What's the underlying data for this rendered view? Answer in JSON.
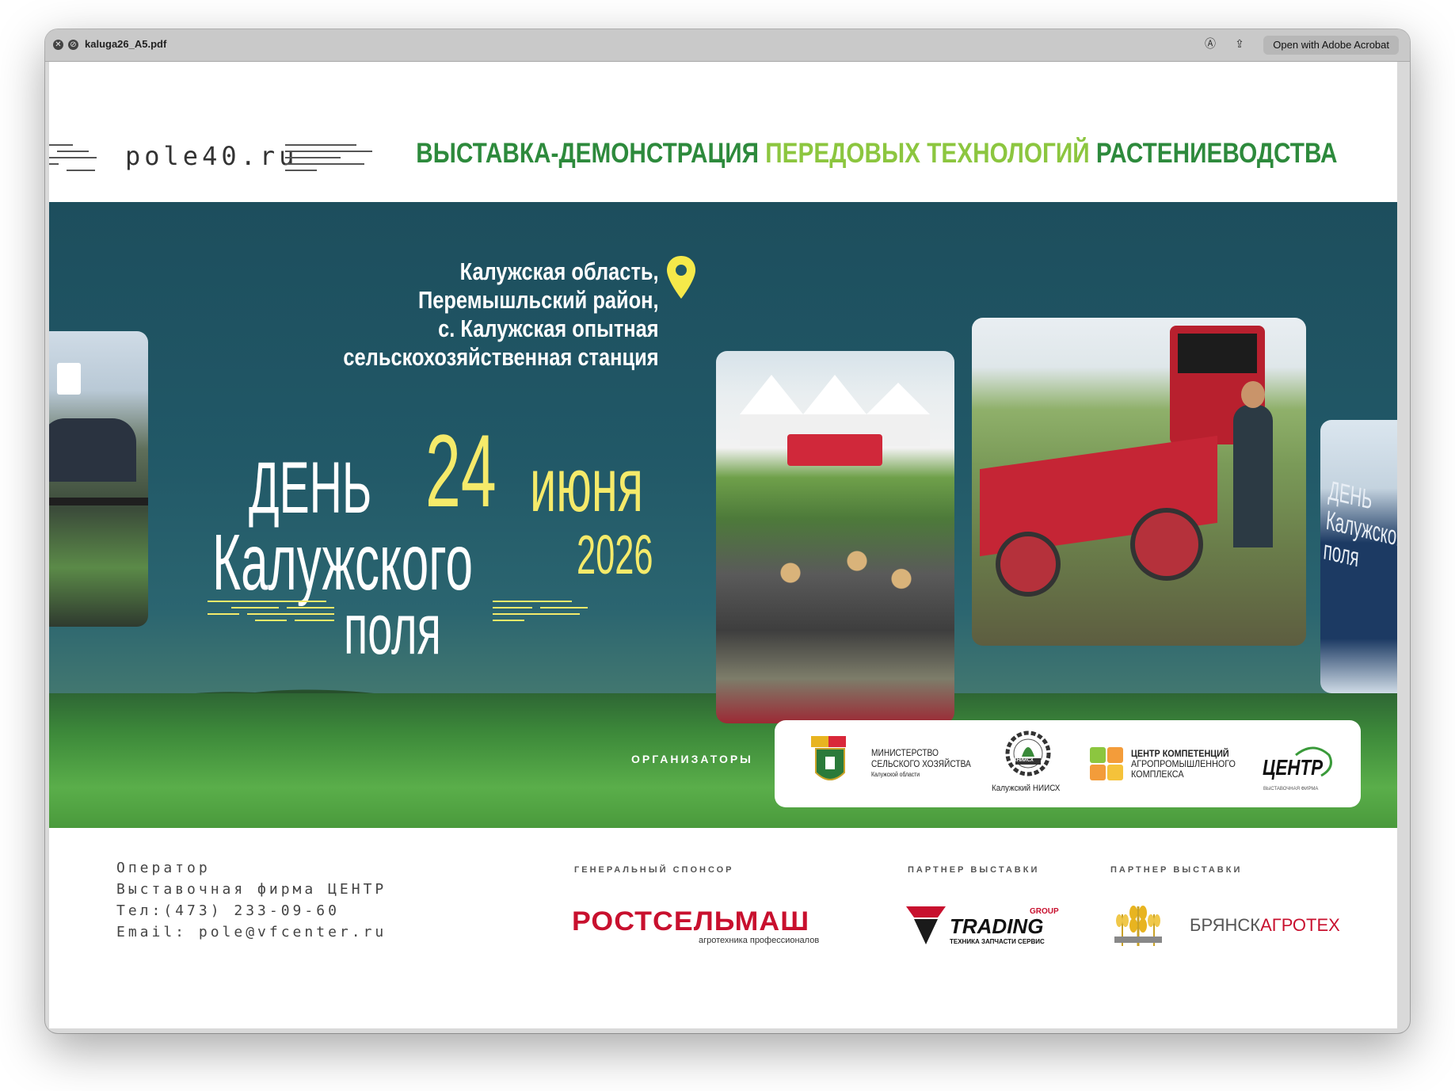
{
  "window": {
    "filename": "kaluga26_A5.pdf",
    "open_with_label": "Open with Adobe Acrobat"
  },
  "document": {
    "site": "pole40.ru",
    "headline_part1": "ВЫСТАВКА-ДЕМОНСТРАЦИЯ ",
    "headline_part2": "ПЕРЕДОВЫХ ТЕХНОЛОГИЙ ",
    "headline_part3": "РАСТЕНИЕВОДСТВА",
    "address": [
      "Калужская область,",
      "Перемышльский район,",
      "с. Калужская опытная",
      "сельскохозяйственная станция"
    ],
    "event_line1": "ДЕНЬ",
    "event_line2": "Калужского",
    "event_line3": "поля",
    "date_day": "24",
    "date_month": "июня",
    "date_year": "2026",
    "photo_banner_text": [
      "ДЕНЬ",
      "Калужского",
      "поля"
    ],
    "organizers_label": "ОРГАНИЗАТОРЫ",
    "organizers": {
      "ministry": [
        "МИНИСТЕРСТВО",
        "СЕЛЬСКОГО ХОЗЯЙСТВА",
        "Калужской области"
      ],
      "niish_logo": "КНИИСХ",
      "niish": "Калужский НИИСХ",
      "competence": [
        "ЦЕНТР КОМПЕТЕНЦИЙ",
        "АГРОПРОМЫШЛЕННОГО",
        "КОМПЛЕКСА"
      ],
      "centr": "ЦЕНТР",
      "centr_sub": "ВЫСТАВОЧНАЯ ФИРМА"
    },
    "operator": [
      "Оператор",
      "Выставочная фирма ЦЕНТР",
      "Тел:(473) 233-09-60",
      "Email: pole@vfcenter.ru"
    ],
    "sponsors": {
      "general_label": "ГЕНЕРАЛЬНЫЙ СПОНСОР",
      "partner1_label": "ПАРТНЕР ВЫСТАВКИ",
      "partner2_label": "ПАРТНЕР ВЫСТАВКИ",
      "rostselmash": "РОСТСЕЛЬМАШ",
      "rostselmash_sub": "агротехника профессионалов",
      "trading_group": "GROUP",
      "trading": "TRADING",
      "trading_sub": "ТЕХНИКА ЗАПЧАСТИ СЕРВИС",
      "bryansk_a": "БРЯНСК",
      "bryansk_b": "АГРОТЕХ"
    },
    "colors": {
      "headline_green": "#2d8a3c",
      "headline_light": "#8cc63f",
      "date_yellow": "#f5ea6a",
      "banner_teal": "#215867",
      "rostselmash_red": "#c8102e"
    }
  }
}
